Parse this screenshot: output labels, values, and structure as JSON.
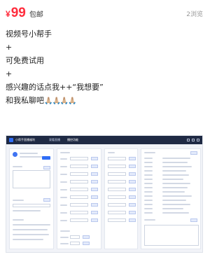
{
  "listing": {
    "currency": "¥",
    "price": "99",
    "tag": "包邮",
    "views": "2浏览"
  },
  "description": {
    "line1": "视频号小帮手",
    "line2": "+",
    "line3": "可免费试用",
    "line4": "+",
    "line5": "感兴趣的话点我++“我想要”",
    "line6_text": "和我私聊吧",
    "line6_emoji": "🙏🏼🙏🏼🙏🏼🙏🏼"
  },
  "screenshot": {
    "app_title": "小帮手直播福利",
    "nav_items": [
      "观看直播",
      "播控功能"
    ],
    "active_nav": 1
  }
}
